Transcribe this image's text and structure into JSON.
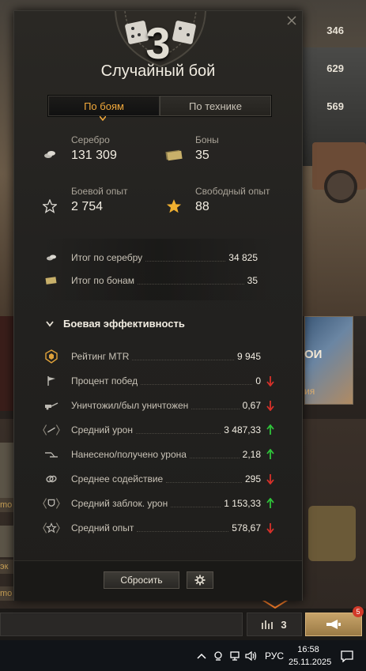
{
  "background": {
    "stats": [
      "346",
      "629",
      "569"
    ],
    "banner_title": "ОИ",
    "banner_sub": "ия",
    "chip_labels": [
      "mo",
      "эк",
      "mo"
    ]
  },
  "panel": {
    "emblem_number": "3",
    "title": "Случайный бой",
    "tabs": [
      {
        "label": "По боям",
        "active": true
      },
      {
        "label": "По технике",
        "active": false
      }
    ],
    "resources": [
      {
        "label": "Серебро",
        "value": "131 309",
        "icon": "silver-icon"
      },
      {
        "label": "Боны",
        "value": "35",
        "icon": "bonds-icon"
      },
      {
        "label": "Боевой опыт",
        "value": "2 754",
        "icon": "star-outline-icon"
      },
      {
        "label": "Свободный опыт",
        "value": "88",
        "icon": "star-gold-icon"
      }
    ],
    "totals": [
      {
        "label": "Итог по серебру",
        "value": "34 825",
        "icon": "silver-icon"
      },
      {
        "label": "Итог по бонам",
        "value": "35",
        "icon": "bonds-icon"
      }
    ],
    "section_title": "Боевая эффективность",
    "metrics": [
      {
        "label": "Рейтинг MTR",
        "value": "9 945",
        "icon": "mtr-rating-icon",
        "trend": "none"
      },
      {
        "label": "Процент побед",
        "value": "0",
        "icon": "flag-icon",
        "trend": "down"
      },
      {
        "label": "Уничтожил/был уничтожен",
        "value": "0,67",
        "icon": "kill-death-icon",
        "trend": "down"
      },
      {
        "label": "Средний урон",
        "value": "3 487,33",
        "icon": "damage-icon",
        "trend": "up"
      },
      {
        "label": "Нанесено/получено урона",
        "value": "2,18",
        "icon": "damage-ratio-icon",
        "trend": "up"
      },
      {
        "label": "Среднее содействие",
        "value": "295",
        "icon": "assist-icon",
        "trend": "down"
      },
      {
        "label": "Средний заблок. урон",
        "value": "1 153,33",
        "icon": "blocked-damage-icon",
        "trend": "up"
      },
      {
        "label": "Средний опыт",
        "value": "578,67",
        "icon": "xp-icon",
        "trend": "down"
      }
    ],
    "reset_label": "Сбросить"
  },
  "bottom": {
    "squad_count": "3",
    "notification_badge": "5"
  },
  "taskbar": {
    "language": "РУС",
    "time": "16:58",
    "date": "25.11.2025"
  },
  "colors": {
    "accent_orange": "#f2a93b",
    "trend_up": "#2fc43a",
    "trend_down": "#d8312a",
    "gold": "#f0b030"
  }
}
